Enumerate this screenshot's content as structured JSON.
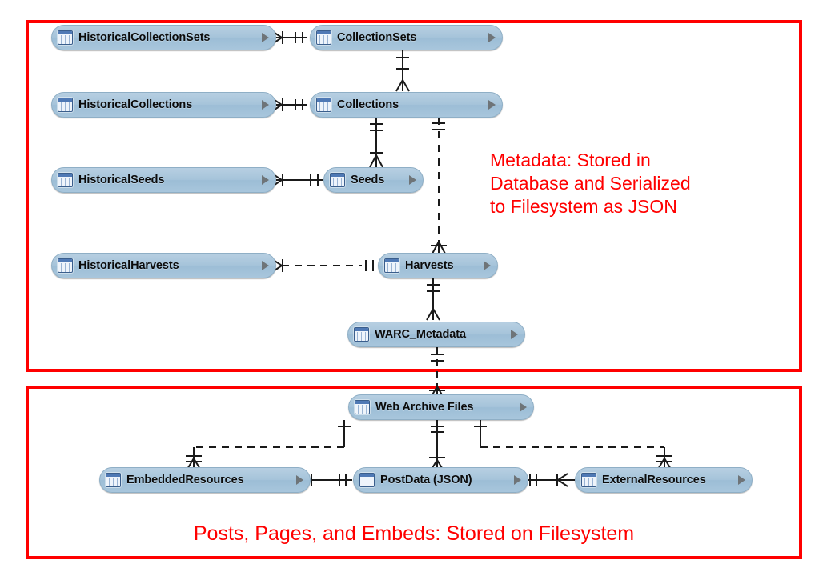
{
  "diagram": {
    "title": "Web archive data model entity-relationship diagram",
    "colors": {
      "group_border": "#ff0000",
      "annotation_text": "#ff0000",
      "entity_fill": "#a6c4da",
      "entity_border": "#8fafc6",
      "connector": "#1a1a1a",
      "background": "#ffffff"
    }
  },
  "groups": [
    {
      "id": "group-metadata",
      "name": "metadata-group",
      "annotation": "Metadata: Stored in\nDatabase and Serialized\nto Filesystem as JSON"
    },
    {
      "id": "group-filesystem",
      "name": "filesystem-group",
      "annotation": "Posts, Pages, and Embeds: Stored on Filesystem"
    }
  ],
  "entities": [
    {
      "id": "historical-collection-sets",
      "label": "HistoricalCollectionSets",
      "icon": "table-icon",
      "disclosure": "disclosure-triangle"
    },
    {
      "id": "collection-sets",
      "label": "CollectionSets",
      "icon": "table-icon",
      "disclosure": "disclosure-triangle"
    },
    {
      "id": "historical-collections",
      "label": "HistoricalCollections",
      "icon": "table-icon",
      "disclosure": "disclosure-triangle"
    },
    {
      "id": "collections",
      "label": "Collections",
      "icon": "table-icon",
      "disclosure": "disclosure-triangle"
    },
    {
      "id": "historical-seeds",
      "label": "HistoricalSeeds",
      "icon": "table-icon",
      "disclosure": "disclosure-triangle"
    },
    {
      "id": "seeds",
      "label": "Seeds",
      "icon": "table-icon",
      "disclosure": "disclosure-triangle"
    },
    {
      "id": "historical-harvests",
      "label": "HistoricalHarvests",
      "icon": "table-icon",
      "disclosure": "disclosure-triangle"
    },
    {
      "id": "harvests",
      "label": "Harvests",
      "icon": "table-icon",
      "disclosure": "disclosure-triangle"
    },
    {
      "id": "warc-metadata",
      "label": "WARC_Metadata",
      "icon": "table-icon",
      "disclosure": "disclosure-triangle"
    },
    {
      "id": "web-archive-files",
      "label": "Web Archive Files",
      "icon": "table-icon",
      "disclosure": "disclosure-triangle"
    },
    {
      "id": "embedded-resources",
      "label": "EmbeddedResources",
      "icon": "table-icon",
      "disclosure": "disclosure-triangle"
    },
    {
      "id": "post-data",
      "label": "PostData (JSON)",
      "icon": "table-icon",
      "disclosure": "disclosure-triangle"
    },
    {
      "id": "external-resources",
      "label": "ExternalResources",
      "icon": "table-icon",
      "disclosure": "disclosure-triangle"
    }
  ],
  "relationships": [
    {
      "from": "historical-collection-sets",
      "to": "collection-sets",
      "style": "solid",
      "from_end": "many-optional",
      "to_end": "one-mandatory"
    },
    {
      "from": "historical-collections",
      "to": "collections",
      "style": "solid",
      "from_end": "many-optional",
      "to_end": "one-mandatory"
    },
    {
      "from": "historical-seeds",
      "to": "seeds",
      "style": "solid",
      "from_end": "many-optional",
      "to_end": "one-mandatory"
    },
    {
      "from": "historical-harvests",
      "to": "harvests",
      "style": "dashed",
      "from_end": "many-optional",
      "to_end": "one-mandatory"
    },
    {
      "from": "collection-sets",
      "to": "collections",
      "style": "solid",
      "from_end": "one-optional",
      "to_end": "many"
    },
    {
      "from": "collections",
      "to": "seeds",
      "style": "solid",
      "from_end": "one-optional",
      "to_end": "many"
    },
    {
      "from": "collections",
      "to": "harvests",
      "style": "dashed",
      "from_end": "one-mandatory",
      "to_end": "many"
    },
    {
      "from": "harvests",
      "to": "warc-metadata",
      "style": "solid",
      "from_end": "one-optional",
      "to_end": "many"
    },
    {
      "from": "warc-metadata",
      "to": "web-archive-files",
      "style": "dashed",
      "from_end": "one-optional",
      "to_end": "many"
    },
    {
      "from": "web-archive-files",
      "to": "embedded-resources",
      "style": "dashed",
      "from_end": "one-optional",
      "to_end": "many"
    },
    {
      "from": "web-archive-files",
      "to": "post-data",
      "style": "solid",
      "from_end": "one-optional",
      "to_end": "many"
    },
    {
      "from": "web-archive-files",
      "to": "external-resources",
      "style": "dashed",
      "from_end": "one-optional",
      "to_end": "many"
    },
    {
      "from": "embedded-resources",
      "to": "post-data",
      "style": "solid",
      "from_end": "many-optional",
      "to_end": "one-mandatory"
    },
    {
      "from": "post-data",
      "to": "external-resources",
      "style": "solid",
      "from_end": "one-mandatory",
      "to_end": "many-optional"
    }
  ]
}
